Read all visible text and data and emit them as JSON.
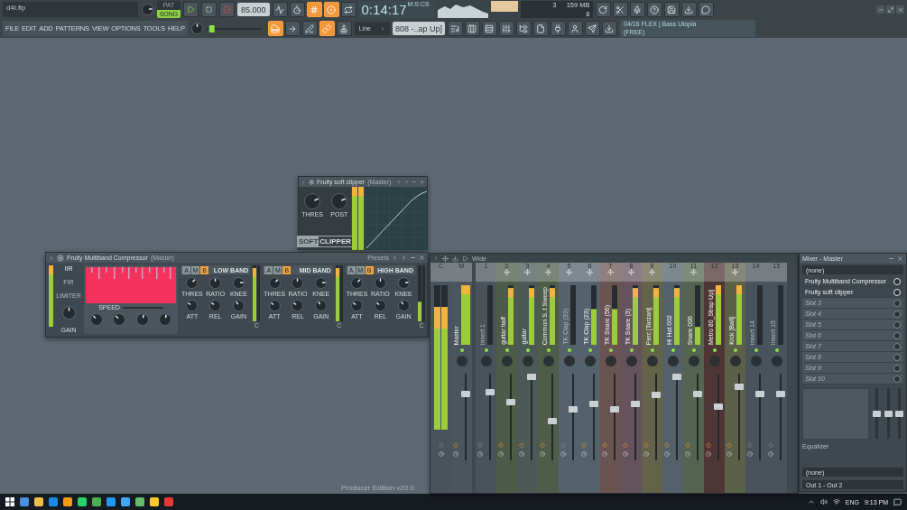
{
  "app": {
    "file_name": "d4l.flp",
    "mode": [
      {
        "label": "PAT",
        "selected": false
      },
      {
        "label": "SONG",
        "selected": true
      }
    ],
    "tempo": "85.000",
    "time": "0:14:17",
    "time_unit": "M:S:CS",
    "cpu": "3",
    "memory": "159 MB",
    "polyphony": "8",
    "menu": [
      "FILE",
      "EDIT",
      "ADD",
      "PATTERNS",
      "VIEW",
      "OPTIONS",
      "TOOLS",
      "HELP"
    ],
    "pitch": {
      "level": 0.05
    },
    "toggles_top": [
      {
        "on": false
      },
      {
        "on": false
      },
      {
        "on": true
      },
      {
        "on": true
      },
      {
        "on": false
      }
    ],
    "toggles_bottom": [
      {
        "on": true
      },
      {
        "on": false
      },
      {
        "on": false
      },
      {
        "on": true
      },
      {
        "on": false
      }
    ],
    "snap": "Line",
    "pattern": "808 -..ap Up]",
    "news": {
      "date": "04/16",
      "title": "FLEX | Bass Utopia",
      "subtitle": "(FREE)"
    }
  },
  "soft_clipper": {
    "title": "Fruity soft clipper",
    "target": "(Master)",
    "knobs": [
      "THRES",
      "POST"
    ],
    "logo": [
      "SOFT",
      "CLIPPER"
    ],
    "meters": [
      {
        "level": 1
      },
      {
        "level": 1
      }
    ]
  },
  "compressor": {
    "title": "Fruity Multiband Compressor",
    "target": "(Master)",
    "presets": "Presets",
    "filter": [
      {
        "label": "IIR",
        "selected": true
      },
      {
        "label": "FIR",
        "selected": false
      }
    ],
    "limiter": "LIMITER",
    "gain": "GAIN",
    "speed": "SPEED",
    "bands": [
      {
        "name": "LOW BAND",
        "modes": [
          {
            "label": "A",
            "selected": false
          },
          {
            "label": "M",
            "selected": false
          },
          {
            "label": "B",
            "selected": true
          }
        ],
        "knobs": [
          "THRES",
          "RATIO",
          "KNEE",
          "ATT",
          "REL",
          "GAIN"
        ],
        "meter": {
          "level": 0.95
        },
        "channel": "C"
      },
      {
        "name": "MID BAND",
        "modes": [
          {
            "label": "A",
            "selected": false
          },
          {
            "label": "M",
            "selected": false
          },
          {
            "label": "B",
            "selected": true
          }
        ],
        "knobs": [
          "THRES",
          "RATIO",
          "KNEE",
          "ATT",
          "REL",
          "GAIN"
        ],
        "meter": {
          "level": 0.95
        },
        "channel": "C"
      },
      {
        "name": "HIGH BAND",
        "modes": [
          {
            "label": "A",
            "selected": false
          },
          {
            "label": "M",
            "selected": false
          },
          {
            "label": "B",
            "selected": true
          }
        ],
        "knobs": [
          "THRES",
          "RATIO",
          "KNEE",
          "ATT",
          "REL",
          "GAIN"
        ],
        "meter": {
          "level": 0.35
        },
        "channel": "C"
      }
    ]
  },
  "mixer": {
    "view": "Wide",
    "tracks": [
      {
        "kind": "current",
        "number": "C",
        "color": "#48535b",
        "meter": {
          "level": 0.85
        },
        "send_on": false,
        "routed": false
      },
      {
        "kind": "master",
        "number": "M",
        "name": "Master",
        "color": "#4a555d",
        "meter": {
          "level": 1
        },
        "fader": {
          "level": 0.79
        },
        "send_on": true,
        "routed": false
      },
      {
        "kind": "insert",
        "number": "1",
        "name": "Insert 1",
        "color": "#48535b",
        "fader": {
          "level": 0.81
        },
        "send_on": false,
        "routed": false
      },
      {
        "kind": "insert",
        "number": "2",
        "name": "guitar half",
        "color": "#4e5b48",
        "meter": {
          "level": 0.95
        },
        "fader": {
          "level": 0.69
        },
        "send_on": true,
        "routed": true
      },
      {
        "kind": "insert",
        "number": "3",
        "name": "guitar",
        "color": "#4b5a57",
        "meter": {
          "level": 0.95
        },
        "fader": {
          "level": 1
        },
        "send_on": true,
        "routed": true
      },
      {
        "kind": "insert",
        "number": "4",
        "name": "Common S..t Sweep",
        "color": "#4f5c4a",
        "meter": {
          "level": 0.95
        },
        "fader": {
          "level": 0.45
        },
        "send_on": true,
        "routed": true
      },
      {
        "kind": "insert",
        "number": "5",
        "name": "TK Clap (33)",
        "color": "#54626b",
        "fader": {
          "level": 0.59
        },
        "send_on": false,
        "routed": true
      },
      {
        "kind": "insert",
        "number": "6",
        "name": "TK Clap (23)",
        "color": "#54626b",
        "meter": {
          "level": 0.6
        },
        "fader": {
          "level": 0.66
        },
        "send_on": true,
        "routed": true
      },
      {
        "kind": "insert",
        "number": "7",
        "name": "TK Snare (56)",
        "color": "#6a5452",
        "meter": {
          "level": 0.6
        },
        "fader": {
          "level": 0.6
        },
        "send_on": true,
        "routed": true
      },
      {
        "kind": "insert",
        "number": "8",
        "name": "TK Snare (3)",
        "color": "#64535d",
        "meter": {
          "level": 0.95
        },
        "fader": {
          "level": 0.66
        },
        "send_on": true,
        "routed": true
      },
      {
        "kind": "insert",
        "number": "9",
        "name": "Perc [Tarzan]",
        "color": "#63634a",
        "meter": {
          "level": 0.95
        },
        "fader": {
          "level": 0.77
        },
        "send_on": true,
        "routed": true
      },
      {
        "kind": "insert",
        "number": "10",
        "name": "Hi Hat 002",
        "color": "#55616a",
        "meter": {
          "level": 0.95
        },
        "fader": {
          "level": 1
        },
        "send_on": true,
        "routed": false
      },
      {
        "kind": "insert",
        "number": "11",
        "name": "Snare 006",
        "color": "#546450",
        "meter": {
          "level": 0.3
        },
        "fader": {
          "level": 0.79
        },
        "send_on": true,
        "routed": true
      },
      {
        "kind": "insert",
        "number": "12",
        "name": "Metro 80_Strap Up]",
        "color": "#4f3636",
        "meter": {
          "level": 1
        },
        "fader": {
          "level": 0.63
        },
        "send_on": true,
        "routed": false
      },
      {
        "kind": "insert",
        "number": "13",
        "name": "Kick [Ball]",
        "color": "#5c6048",
        "meter": {
          "level": 1
        },
        "fader": {
          "level": 0.88
        },
        "send_on": true,
        "routed": true
      },
      {
        "kind": "insert",
        "number": "14",
        "name": "Insert 14",
        "color": "#48535b",
        "fader": {
          "level": 0.79
        },
        "send_on": false,
        "routed": false
      },
      {
        "kind": "insert",
        "number": "15",
        "name": "Insert 15",
        "color": "#48535b",
        "fader": {
          "level": 0.79
        },
        "send_on": false,
        "routed": false
      }
    ]
  },
  "mixer_panel": {
    "title": "Mixer - Master",
    "input": "(none)",
    "slots": [
      {
        "label": "Fruity Multiband Compressor",
        "empty": false
      },
      {
        "label": "Fruity soft clipper",
        "empty": false
      },
      {
        "label": "Slot 3",
        "empty": true
      },
      {
        "label": "Slot 4",
        "empty": true
      },
      {
        "label": "Slot 5",
        "empty": true
      },
      {
        "label": "Slot 6",
        "empty": true
      },
      {
        "label": "Slot 7",
        "empty": true
      },
      {
        "label": "Slot 8",
        "empty": true
      },
      {
        "label": "Slot 9",
        "empty": true
      },
      {
        "label": "Slot 10",
        "empty": true
      }
    ],
    "eq_label": "Equalizer",
    "eq_faders": [
      {
        "level": 0.5
      },
      {
        "level": 0.5
      },
      {
        "level": 0.5
      }
    ],
    "output_fx": "(none)",
    "output": "Out 1 - Out 2"
  },
  "version": "Producer Edition v20.0",
  "taskbar": {
    "language": "ENG",
    "clock": "9:13 PM"
  }
}
